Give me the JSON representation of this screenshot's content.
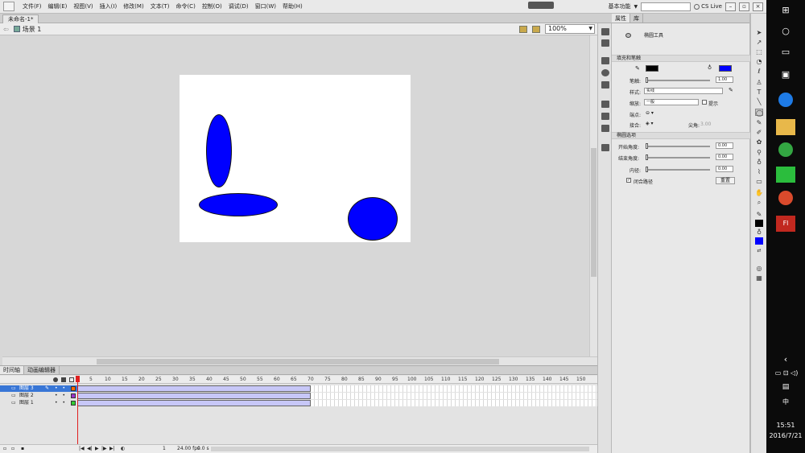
{
  "menubar": {
    "items": [
      "文件(F)",
      "编辑(E)",
      "视图(V)",
      "插入(I)",
      "修改(M)",
      "文本(T)",
      "命令(C)",
      "控制(O)",
      "调试(D)",
      "窗口(W)",
      "帮助(H)"
    ],
    "workspace_label": "基本功能",
    "cslive_label": "CS Live"
  },
  "document": {
    "tab_label": "未命名-1*"
  },
  "scene": {
    "label": "场景 1",
    "zoom": "100%"
  },
  "stage": {
    "background": "#ffffff",
    "shape_fill": "#0000ff"
  },
  "timeline": {
    "tabs": [
      "时间轴",
      "动画编辑器"
    ],
    "frame_numbers": [
      "5",
      "10",
      "15",
      "20",
      "25",
      "30",
      "35",
      "40",
      "45",
      "50",
      "55",
      "60",
      "65",
      "70",
      "75",
      "80",
      "85",
      "90",
      "95",
      "100",
      "105",
      "110",
      "115",
      "120",
      "125",
      "130",
      "135",
      "140",
      "145",
      "150"
    ],
    "layers": [
      {
        "name": "图层 3",
        "color": "#ff6600",
        "selected": true
      },
      {
        "name": "图层 2",
        "color": "#9933cc",
        "selected": false
      },
      {
        "name": "图层 1",
        "color": "#33cc33",
        "selected": false
      }
    ],
    "footer": {
      "frame": "1",
      "fps": "24.00 fps",
      "time": "0.0 s"
    }
  },
  "properties": {
    "tabs": [
      "属性",
      "库"
    ],
    "tool_name": "椭圆工具",
    "section_fill_stroke": "填充和笔触",
    "stroke_color": "#000000",
    "fill_color": "#0000ff",
    "stroke_label": "笔触:",
    "stroke_value": "1.00",
    "style_label": "样式:",
    "style_value": "实线",
    "scale_label": "缩放:",
    "scale_value": "一般",
    "hint_label": "提示",
    "cap_label": "端点:",
    "join_label": "接合:",
    "miter_label": "尖角:",
    "miter_value": "3.00",
    "section_ellipse": "椭圆选项",
    "start_angle_label": "开始角度:",
    "start_angle_value": "0.00",
    "end_angle_label": "结束角度:",
    "end_angle_value": "0.00",
    "inner_radius_label": "内径:",
    "inner_radius_value": "0.00",
    "close_path_label": "闭合路径",
    "reset_label": "重置"
  },
  "taskbar": {
    "time": "15:51",
    "date": "2016/7/21",
    "ime": "中"
  }
}
